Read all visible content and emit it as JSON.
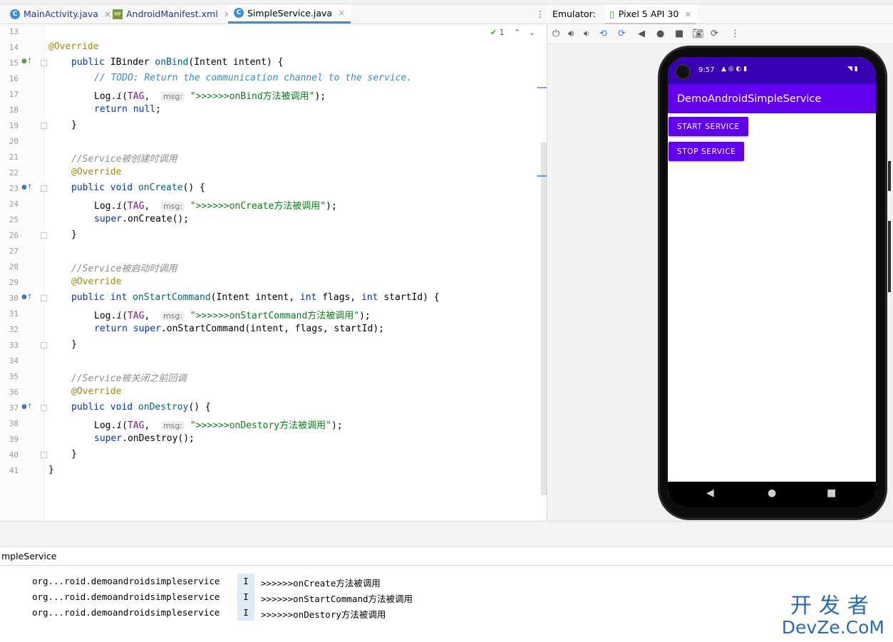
{
  "tabs": [
    {
      "icon": "C",
      "label": "MainActivity.java",
      "close": "×"
    },
    {
      "icon": "MF",
      "label": "AndroidManifest.xml",
      "close": "×"
    },
    {
      "icon": "C",
      "label": "SimpleService.java",
      "close": "×"
    }
  ],
  "tabs_menu": "⋮",
  "inspection_count": "1",
  "code": {
    "l13": "",
    "l14_ann": "@Override",
    "l15_a": "public ",
    "l15_b": "IBinder ",
    "l15_c": "onBind",
    "l15_d": "(Intent intent) {",
    "l16_a": "// ",
    "l16_b": "TODO: Return the communication channel to the service.",
    "l17_a": "Log.",
    "l17_b": "i",
    "l17_c": "(",
    "l17_d": "TAG",
    "l17_e": ",  ",
    "l17_hint": "msg:",
    "l17_str": "\">>>>>>onBind方法被调用\"",
    "l17_end": ");",
    "l18_a": "return null",
    "l18_b": ";",
    "l19": "}",
    "l21": "//Service被创建时调用",
    "l22": "@Override",
    "l23_a": "public void ",
    "l23_b": "onCreate",
    "l23_c": "() {",
    "l24_a": "Log.",
    "l24_b": "i",
    "l24_c": "(",
    "l24_d": "TAG",
    "l24_e": ",  ",
    "l24_hint": "msg:",
    "l24_str": "\">>>>>>onCreate方法被调用\"",
    "l24_end": ");",
    "l25_a": "super",
    "l25_b": ".onCreate();",
    "l26": "}",
    "l28": "//Service被启动时调用",
    "l29": "@Override",
    "l30_a": "public int ",
    "l30_b": "onStartCommand",
    "l30_c": "(Intent intent, ",
    "l30_d": "int ",
    "l30_e": "flags, ",
    "l30_f": "int ",
    "l30_g": "startId) {",
    "l31_a": "Log.",
    "l31_b": "i",
    "l31_c": "(",
    "l31_d": "TAG",
    "l31_e": ",  ",
    "l31_hint": "msg:",
    "l31_str": "\">>>>>>onStartCommand方法被调用\"",
    "l31_end": ");",
    "l32_a": "return super",
    "l32_b": ".onStartCommand(intent, flags, startId);",
    "l33": "}",
    "l35": "//Service被关闭之前回调",
    "l36": "@Override",
    "l37_a": "public void ",
    "l37_b": "onDestroy",
    "l37_c": "() {",
    "l38_a": "Log.",
    "l38_b": "i",
    "l38_c": "(",
    "l38_d": "TAG",
    "l38_e": ",  ",
    "l38_hint": "msg:",
    "l38_str": "\">>>>>>onDestory方法被调用\"",
    "l38_end": ");",
    "l39_a": "super",
    "l39_b": ".onDestroy();",
    "l40": "}",
    "l41": "}"
  },
  "line_numbers": [
    "13",
    "14",
    "15",
    "16",
    "17",
    "18",
    "19",
    "20",
    "21",
    "22",
    "23",
    "24",
    "25",
    "26",
    "27",
    "28",
    "29",
    "30",
    "31",
    "32",
    "33",
    "34",
    "35",
    "36",
    "37",
    "38",
    "39",
    "40",
    "41"
  ],
  "emulator": {
    "label": "Emulator:",
    "device": "Pixel 5 API 30",
    "close": "×"
  },
  "phone": {
    "time": "9:57",
    "app_title": "DemoAndroidSimpleService",
    "start_button": "START SERVICE",
    "stop_button": "STOP SERVICE",
    "nav_back": "◀",
    "nav_home": "●",
    "nav_recents": "■"
  },
  "logcat": {
    "filter_label": "mpleService",
    "rows": [
      {
        "pkg": "org...roid.demoandroidsimpleservice",
        "level": "I",
        "msg": ">>>>>>onCreate方法被调用"
      },
      {
        "pkg": "org...roid.demoandroidsimpleservice",
        "level": "I",
        "msg": ">>>>>>onStartCommand方法被调用"
      },
      {
        "pkg": "org...roid.demoandroidsimpleservice",
        "level": "I",
        "msg": ">>>>>>onDestory方法被调用"
      }
    ]
  },
  "watermark": {
    "cn": "开发者",
    "en": "DevZe.CoM"
  },
  "colors": {
    "accent_purple": "#6200ee",
    "status_purple": "#3700b3",
    "tab_underline": "#4a86c8"
  }
}
